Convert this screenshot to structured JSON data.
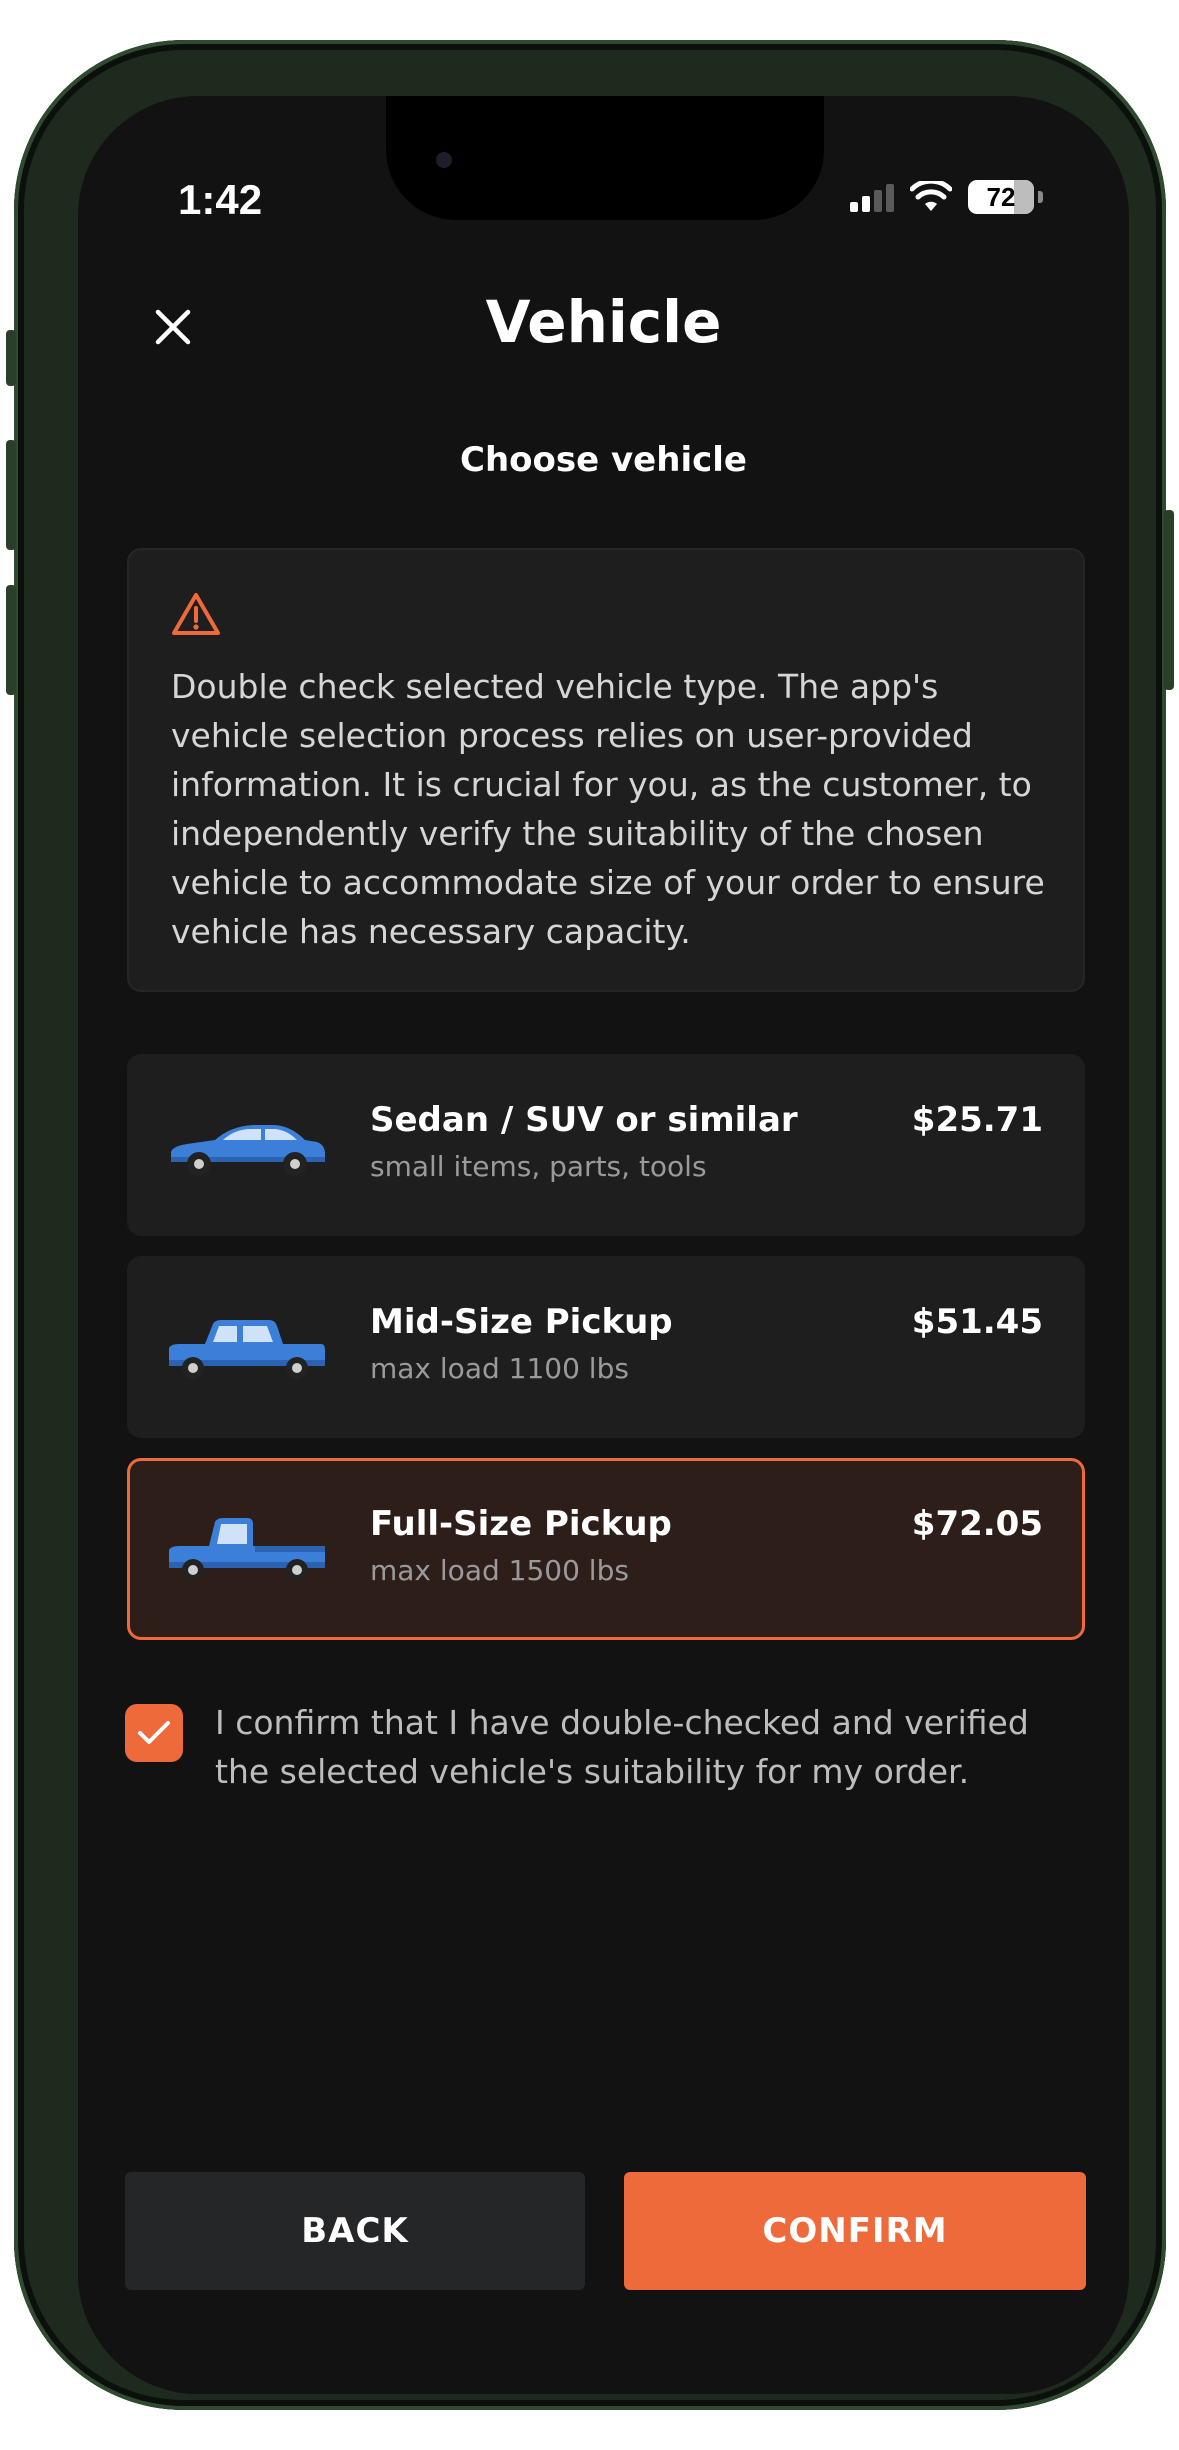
{
  "status_bar": {
    "time": "1:42",
    "battery": "72",
    "icons": [
      "signal-icon",
      "wifi-icon",
      "battery-icon"
    ]
  },
  "header": {
    "title": "Vehicle",
    "close_icon": "close-icon"
  },
  "subtitle": "Choose vehicle",
  "warning": {
    "icon": "warning-triangle-icon",
    "text": "Double check selected vehicle type. The app's vehicle selection process relies on user-provided information. It is crucial for you, as the customer, to independently verify the suitability of the chosen vehicle to accommodate size of your order to ensure vehicle has necessary capacity."
  },
  "vehicles": [
    {
      "name": "Sedan / SUV or similar",
      "description": "small items, parts, tools",
      "price": "$25.71",
      "selected": false,
      "icon": "sedan-icon"
    },
    {
      "name": "Mid-Size Pickup",
      "description": "max load 1100 lbs",
      "price": "$51.45",
      "selected": false,
      "icon": "midsize-pickup-icon"
    },
    {
      "name": "Full-Size Pickup",
      "description": "max load 1500 lbs",
      "price": "$72.05",
      "selected": true,
      "icon": "fullsize-pickup-icon"
    }
  ],
  "confirmation": {
    "checked": true,
    "text": "I confirm that I have double-checked and verified the selected vehicle's suitability for my order."
  },
  "actions": {
    "back_label": "BACK",
    "confirm_label": "CONFIRM"
  },
  "colors": {
    "accent": "#ee6a3b",
    "background": "#121212",
    "card": "#1e1e1e",
    "selected_card": "#2e1e1a",
    "vehicle_blue": "#3c7fd9"
  }
}
